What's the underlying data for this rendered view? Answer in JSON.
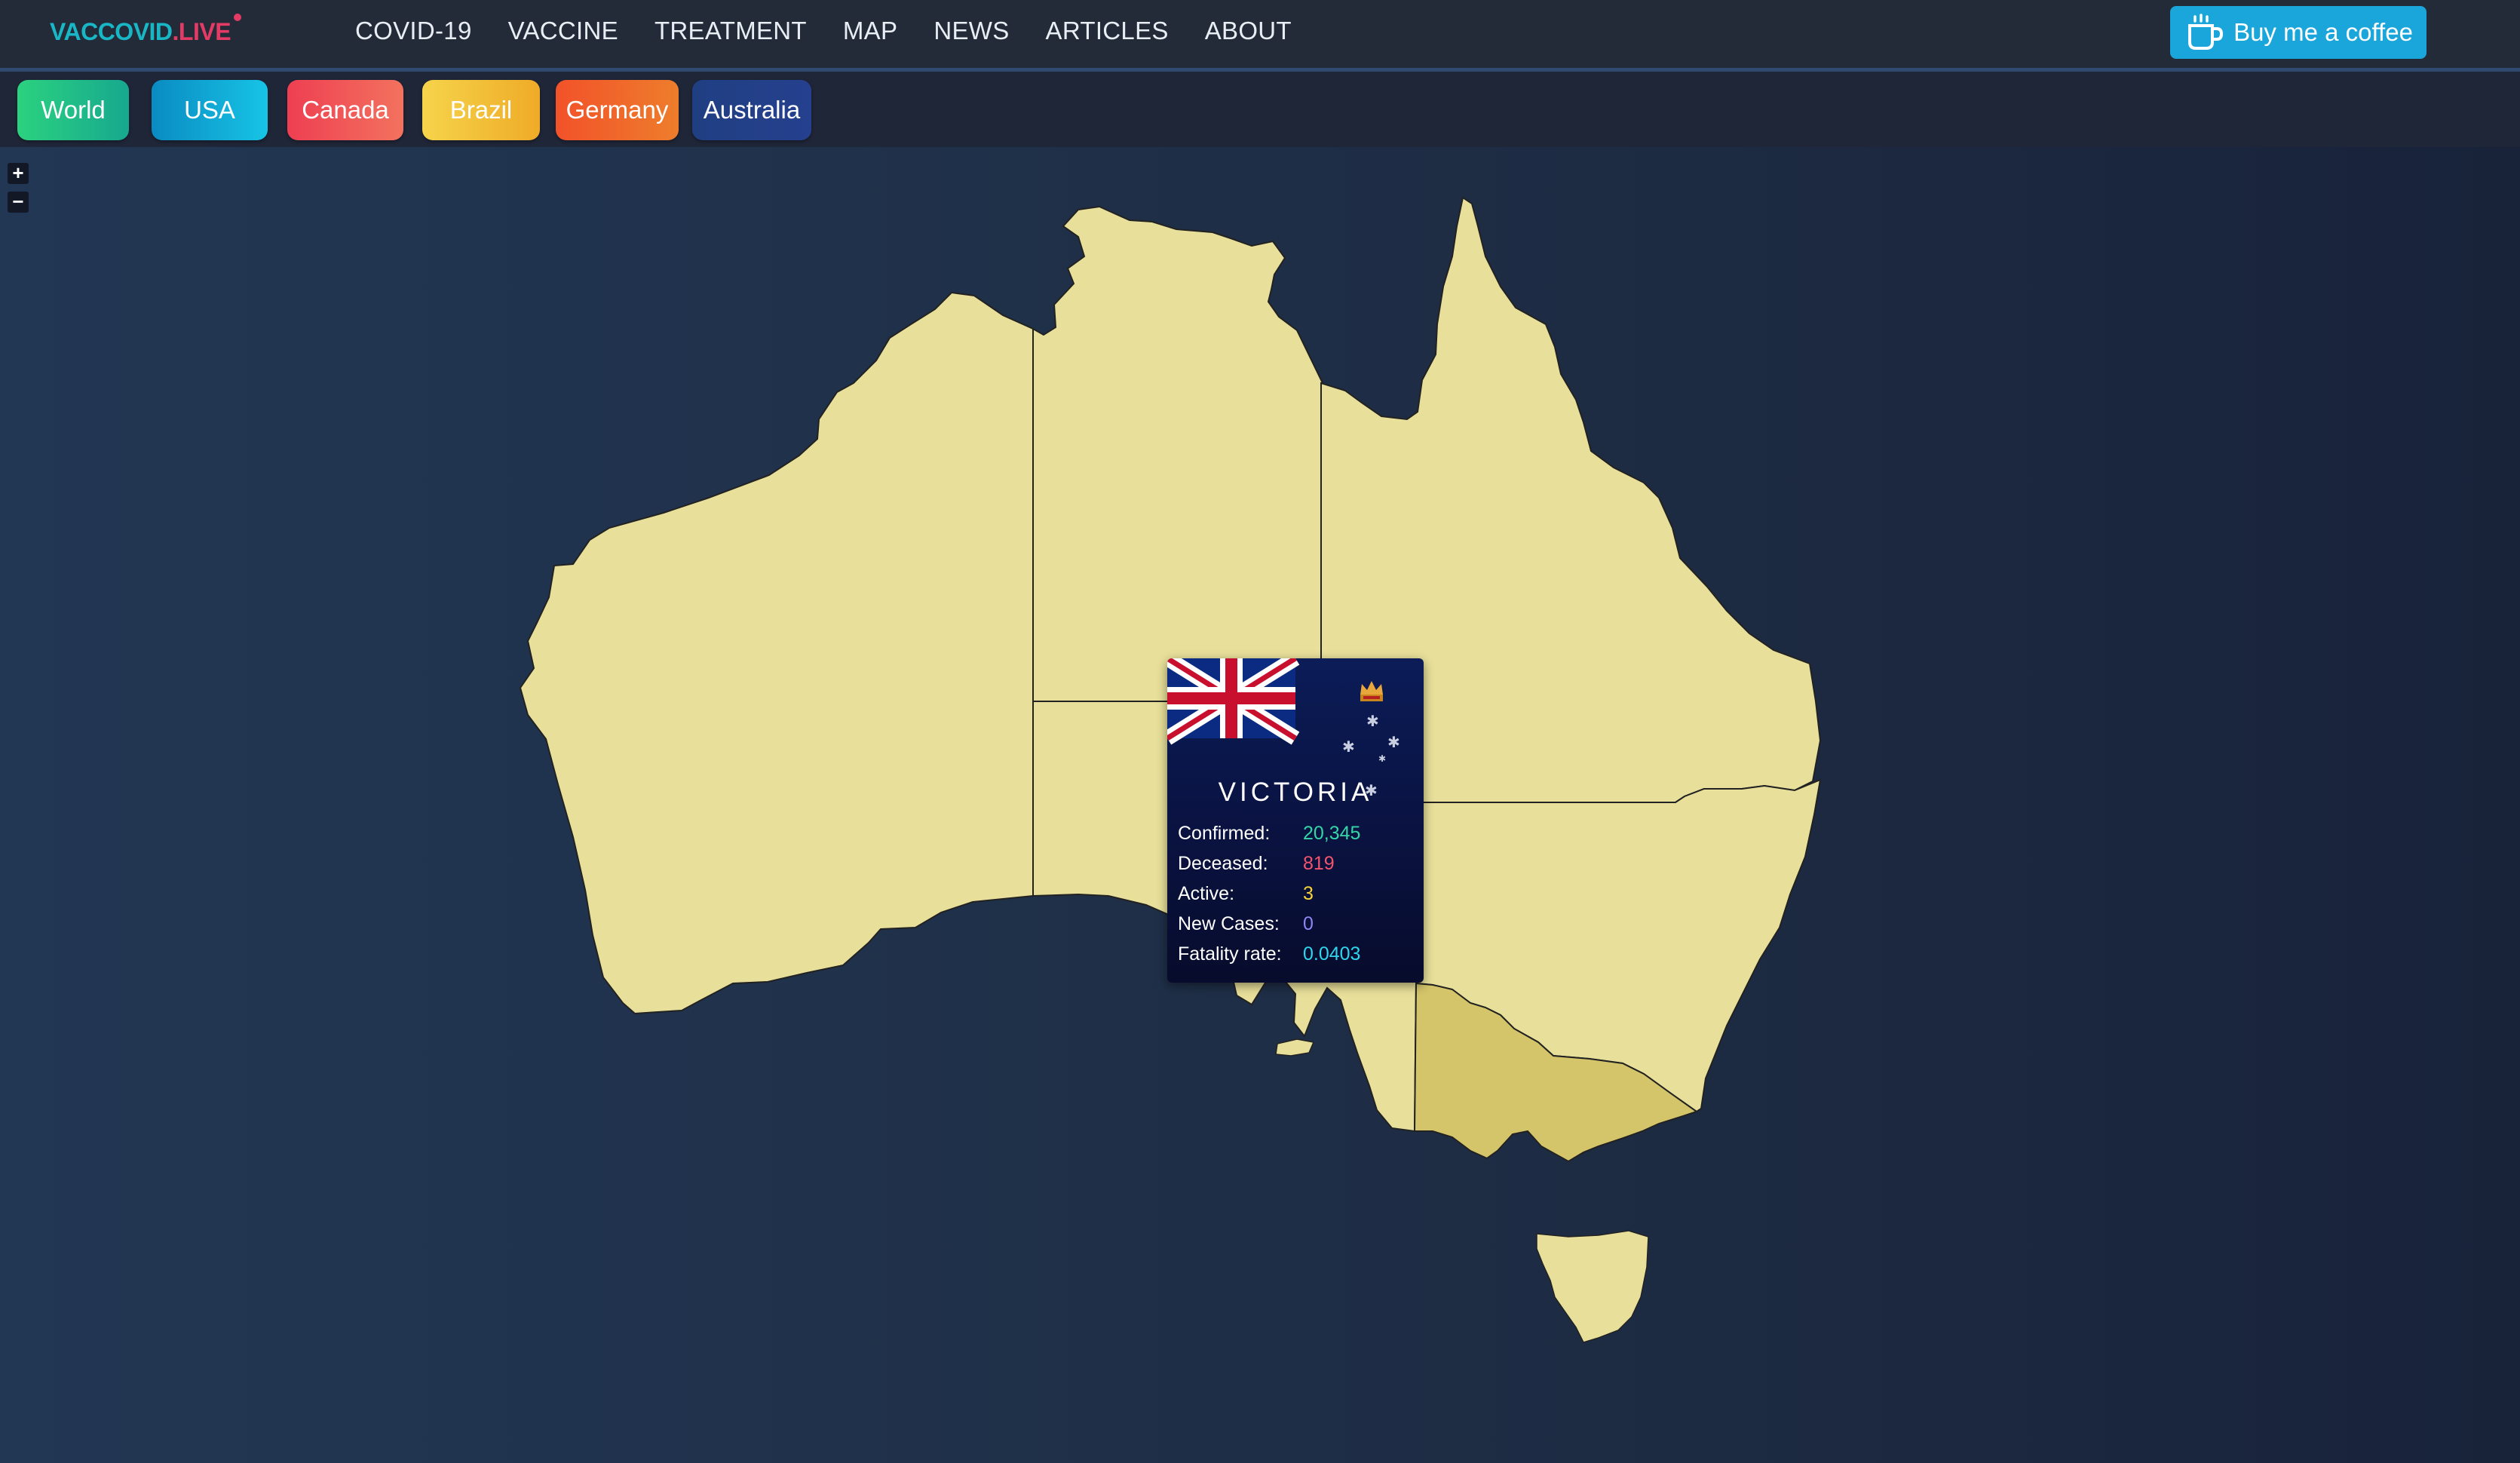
{
  "logo": {
    "part1": "VACCOVID",
    "part2": ".LIVE"
  },
  "nav": {
    "items": [
      {
        "label": "COVID-19"
      },
      {
        "label": "VACCINE"
      },
      {
        "label": "TREATMENT"
      },
      {
        "label": "MAP"
      },
      {
        "label": "NEWS"
      },
      {
        "label": "ARTICLES"
      },
      {
        "label": "ABOUT"
      }
    ],
    "coffee_label": "Buy me a coffee",
    "coffee_icon": "coffee-cup-icon"
  },
  "tabs": [
    {
      "label": "World",
      "color_from": "#2bd27f",
      "color_to": "#17a88f"
    },
    {
      "label": "USA",
      "color_from": "#0a8bc2",
      "color_to": "#17c4e6"
    },
    {
      "label": "Canada",
      "color_from": "#ee3f52",
      "color_to": "#f3725e"
    },
    {
      "label": "Brazil",
      "color_from": "#f6d44b",
      "color_to": "#efab27"
    },
    {
      "label": "Germany",
      "color_from": "#f2522a",
      "color_to": "#ee7d2b"
    },
    {
      "label": "Australia",
      "color_from": "#203f82",
      "color_to": "#25408e"
    }
  ],
  "map": {
    "zoom_in": "+",
    "zoom_out": "−",
    "land_color": "#e8e09a",
    "highlight_color": "#d4c56a"
  },
  "tooltip": {
    "state": "VICTORIA",
    "rows": [
      {
        "label": "Confirmed:",
        "value": "20,345",
        "color": "#34d6a8"
      },
      {
        "label": "Deceased:",
        "value": "819",
        "color": "#f2546e"
      },
      {
        "label": "Active:",
        "value": "3",
        "color": "#f4d33b"
      },
      {
        "label": "New Cases:",
        "value": "0",
        "color": "#8d86f5"
      },
      {
        "label": "Fatality rate:",
        "value": "0.0403",
        "color": "#2ed6ee"
      }
    ]
  }
}
